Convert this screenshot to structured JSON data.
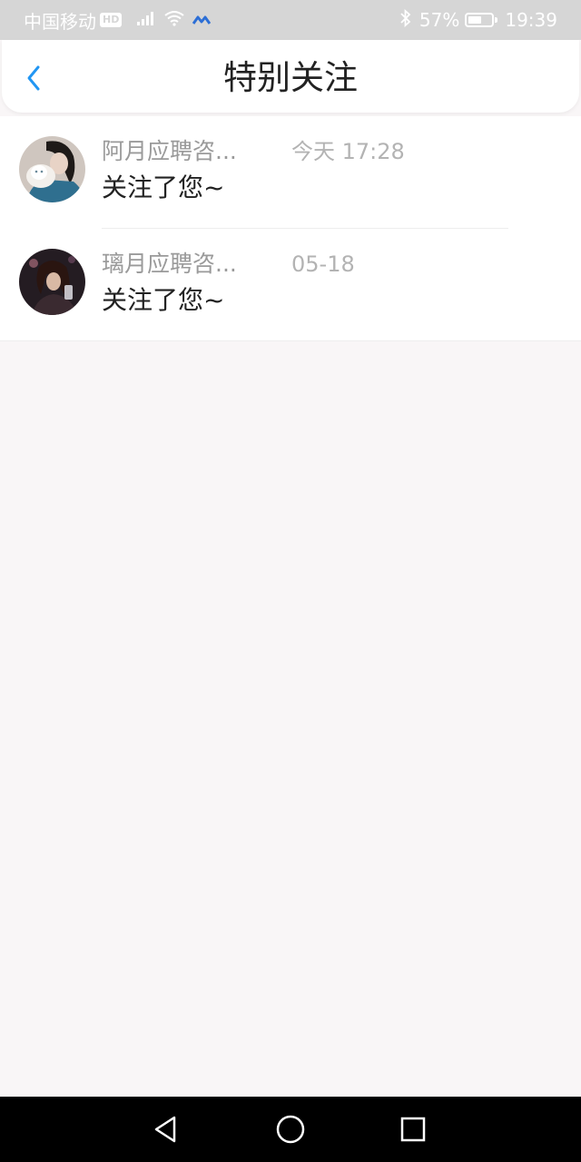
{
  "status_bar": {
    "carrier": "中国移动",
    "hd_badge": "HD",
    "battery_percent": "57%",
    "battery_level": 0.57,
    "time": "19:39",
    "icons": [
      "signal-icon",
      "wifi-icon",
      "data-sync-icon",
      "bluetooth-icon",
      "battery-icon"
    ]
  },
  "header": {
    "title": "特别关注",
    "back_icon": "chevron-left-icon"
  },
  "followers": [
    {
      "name": "阿月应聘咨...",
      "time": "今天 17:28",
      "message": "关注了您~",
      "avatar": "avatar-photo"
    },
    {
      "name": "璃月应聘咨...",
      "time": "05-18",
      "message": "关注了您~",
      "avatar": "avatar-photo"
    }
  ],
  "system_nav": {
    "icons": [
      "back-triangle-icon",
      "home-circle-icon",
      "recents-square-icon"
    ]
  },
  "colors": {
    "accent": "#2196f3",
    "status_bar_bg": "#d6d6d6",
    "page_bg": "#f9f6f7",
    "title_text": "#222222",
    "muted_text": "#9a9a9a"
  }
}
